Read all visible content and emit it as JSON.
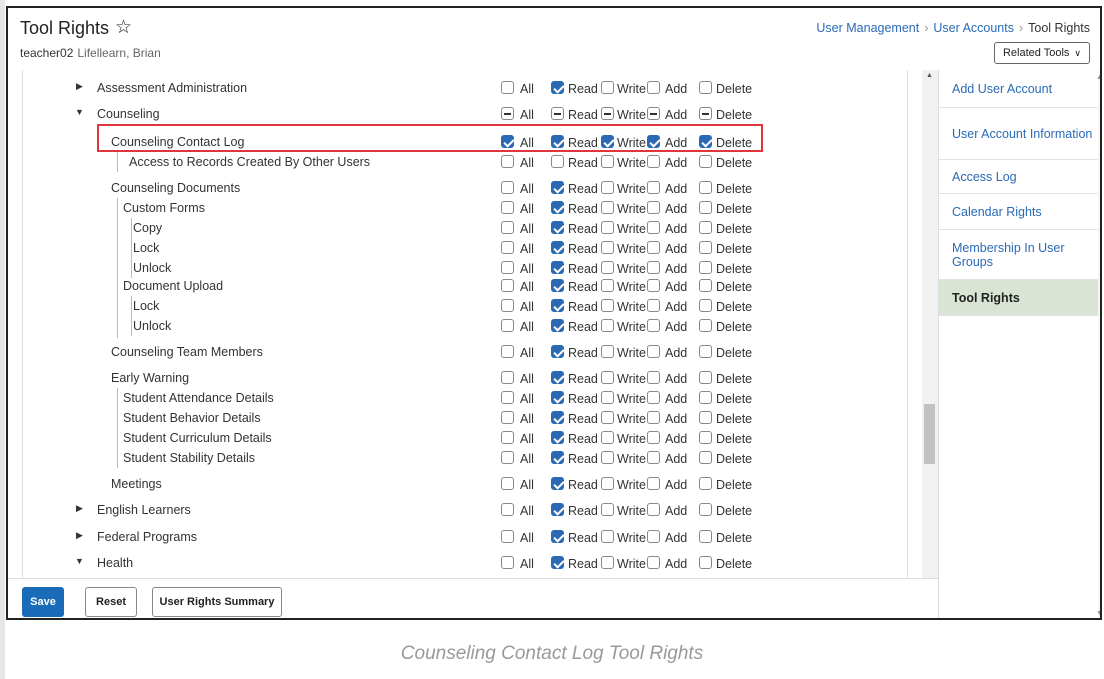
{
  "header": {
    "title": "Tool Rights",
    "username": "teacher02",
    "person_name": "Lifellearn, Brian",
    "breadcrumb": [
      "User Management",
      "User Accounts",
      "Tool Rights"
    ],
    "related_tools_label": "Related Tools"
  },
  "permission_labels": [
    "All",
    "Read",
    "Write",
    "Add",
    "Delete"
  ],
  "tree": [
    {
      "label": "Assessment Administration",
      "arrow": "right",
      "state": [
        "off",
        "on",
        "off",
        "off",
        "off"
      ]
    },
    {
      "label": "Counseling",
      "arrow": "down",
      "state": [
        "part",
        "part",
        "part",
        "part",
        "part"
      ]
    },
    {
      "label": "Counseling Contact Log",
      "state": [
        "on",
        "on",
        "on",
        "on",
        "on"
      ]
    },
    {
      "label": "Access to Records Created By Other Users",
      "state": [
        "off",
        "off",
        "off",
        "off",
        "off"
      ]
    },
    {
      "label": "Counseling Documents",
      "state": [
        "off",
        "on",
        "off",
        "off",
        "off"
      ]
    },
    {
      "label": "Custom Forms",
      "state": [
        "off",
        "on",
        "off",
        "off",
        "off"
      ]
    },
    {
      "label": "Copy",
      "state": [
        "off",
        "on",
        "off",
        "off",
        "off"
      ]
    },
    {
      "label": "Lock",
      "state": [
        "off",
        "on",
        "off",
        "off",
        "off"
      ]
    },
    {
      "label": "Unlock",
      "state": [
        "off",
        "on",
        "off",
        "off",
        "off"
      ]
    },
    {
      "label": "Document Upload",
      "state": [
        "off",
        "on",
        "off",
        "off",
        "off"
      ]
    },
    {
      "label": "Lock",
      "state": [
        "off",
        "on",
        "off",
        "off",
        "off"
      ]
    },
    {
      "label": "Unlock",
      "state": [
        "off",
        "on",
        "off",
        "off",
        "off"
      ]
    },
    {
      "label": "Counseling Team Members",
      "state": [
        "off",
        "on",
        "off",
        "off",
        "off"
      ]
    },
    {
      "label": "Early Warning",
      "state": [
        "off",
        "on",
        "off",
        "off",
        "off"
      ]
    },
    {
      "label": "Student Attendance Details",
      "state": [
        "off",
        "on",
        "off",
        "off",
        "off"
      ]
    },
    {
      "label": "Student Behavior Details",
      "state": [
        "off",
        "on",
        "off",
        "off",
        "off"
      ]
    },
    {
      "label": "Student Curriculum Details",
      "state": [
        "off",
        "on",
        "off",
        "off",
        "off"
      ]
    },
    {
      "label": "Student Stability Details",
      "state": [
        "off",
        "on",
        "off",
        "off",
        "off"
      ]
    },
    {
      "label": "Meetings",
      "state": [
        "off",
        "on",
        "off",
        "off",
        "off"
      ]
    },
    {
      "label": "English Learners",
      "arrow": "right",
      "state": [
        "off",
        "on",
        "off",
        "off",
        "off"
      ]
    },
    {
      "label": "Federal Programs",
      "arrow": "right",
      "state": [
        "off",
        "on",
        "off",
        "off",
        "off"
      ]
    },
    {
      "label": "Health",
      "arrow": "down",
      "state": [
        "off",
        "on",
        "off",
        "off",
        "off"
      ]
    }
  ],
  "sidenav": {
    "items": [
      "Add User Account",
      "User Account Information",
      "Access Log",
      "Calendar Rights",
      "Membership In User Groups",
      "Tool Rights"
    ],
    "active": "Tool Rights"
  },
  "footer": {
    "save": "Save",
    "reset": "Reset",
    "summary": "User Rights Summary"
  },
  "caption": "Counseling Contact Log Tool Rights"
}
